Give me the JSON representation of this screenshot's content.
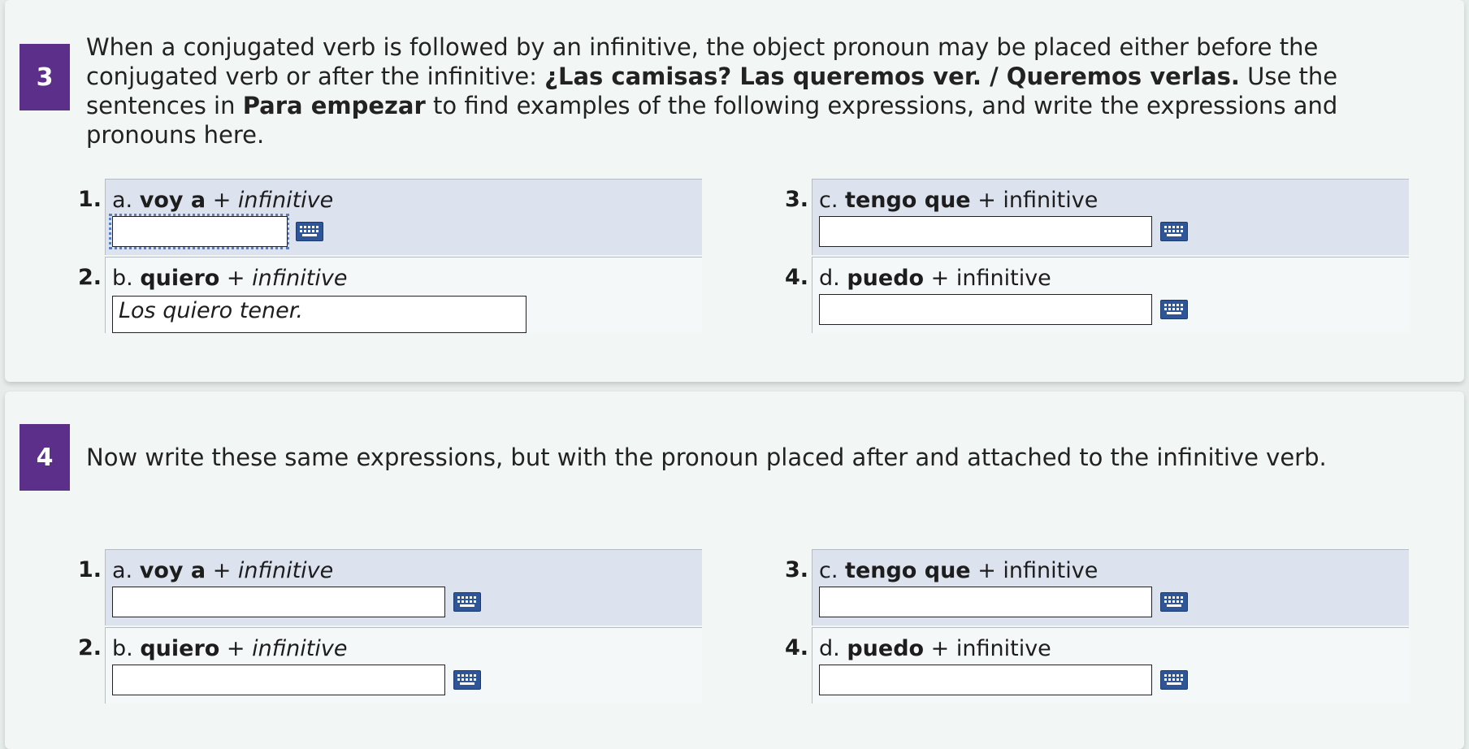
{
  "colors": {
    "badge": "#5b2f8a",
    "keyboard_icon": "#2e5597",
    "shaded_row": "#dde3ee"
  },
  "sections": [
    {
      "number": "3",
      "instruction_parts": [
        {
          "text": "When a conjugated verb is followed by an infinitive, the object pronoun may be placed either before the conjugated verb or after the infinitive: ",
          "bold": false
        },
        {
          "text": "¿Las camisas? Las queremos ver. / Queremos verlas.",
          "bold": true
        },
        {
          "text": " Use the sentences in ",
          "bold": false
        },
        {
          "text": "Para empezar",
          "bold": true
        },
        {
          "text": " to find examples of the following expressions, and write the expressions and pronouns here.",
          "bold": false
        }
      ],
      "items": [
        {
          "index": "1.",
          "letter": "a.",
          "phrase": "voy a",
          "plus": " + ",
          "tail": "infinitive",
          "tail_italic": true,
          "answer": "",
          "shaded": true
        },
        {
          "index": "2.",
          "letter": "b.",
          "phrase": "quiero",
          "plus": " + ",
          "tail": "infinitive",
          "tail_italic": true,
          "answer": "Los quiero tener.",
          "shaded": false
        },
        {
          "index": "3.",
          "letter": "c.",
          "phrase": "tengo que",
          "plus": " + ",
          "tail": "infinitive",
          "tail_italic": false,
          "answer": "",
          "shaded": true
        },
        {
          "index": "4.",
          "letter": "d.",
          "phrase": "puedo",
          "plus": " + ",
          "tail": "infinitive",
          "tail_italic": false,
          "answer": "",
          "shaded": false
        }
      ]
    },
    {
      "number": "4",
      "instruction": "Now write these same expressions, but with the pronoun placed after and attached to the infinitive verb.",
      "items": [
        {
          "index": "1.",
          "letter": "a.",
          "phrase": "voy a",
          "plus": " + ",
          "tail": "infinitive",
          "tail_italic": true,
          "answer": "",
          "shaded": true
        },
        {
          "index": "2.",
          "letter": "b.",
          "phrase": "quiero",
          "plus": " + ",
          "tail": "infinitive",
          "tail_italic": true,
          "answer": "",
          "shaded": false
        },
        {
          "index": "3.",
          "letter": "c.",
          "phrase": "tengo que",
          "plus": " + ",
          "tail": "infinitive",
          "tail_italic": false,
          "answer": "",
          "shaded": true
        },
        {
          "index": "4.",
          "letter": "d.",
          "phrase": "puedo",
          "plus": " + ",
          "tail": "infinitive",
          "tail_italic": false,
          "answer": "",
          "shaded": false
        }
      ]
    }
  ],
  "icons": {
    "keyboard": "keyboard-icon"
  }
}
